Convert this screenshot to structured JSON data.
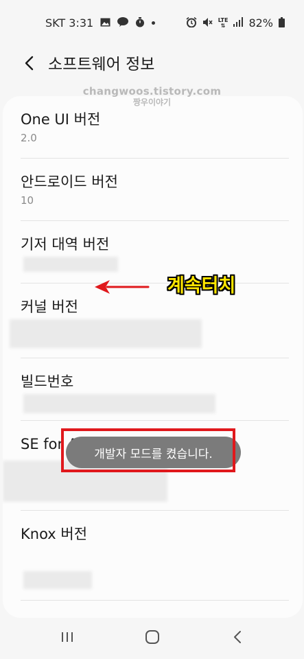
{
  "status_bar": {
    "carrier": "SKT",
    "time": "3:31",
    "lte": "LTE",
    "battery": "82%",
    "icons": [
      "gallery-icon",
      "talk-icon",
      "timer-icon",
      "alarm-icon",
      "mute-icon",
      "signal-icon",
      "battery-icon"
    ]
  },
  "header": {
    "title": "소프트웨어 정보"
  },
  "watermark": {
    "line1": "changwoos.tistory.com",
    "line2": "짱우이야기"
  },
  "items": [
    {
      "title": "One UI 버전",
      "value": "2.0"
    },
    {
      "title": "안드로이드 버전",
      "value": "10"
    },
    {
      "title": "기저 대역 버전",
      "value": ""
    },
    {
      "title": "커널 버전",
      "value": ""
    },
    {
      "title": "빌드번호",
      "value": ""
    },
    {
      "title": "SE for Android 상태",
      "value": ""
    },
    {
      "title": "Knox 버전",
      "value": ""
    }
  ],
  "annotation": {
    "text": "계속터치",
    "arrow_color": "#e0181c",
    "text_color": "#ffe600"
  },
  "toast": {
    "message": "개발자 모드를 켰습니다."
  },
  "nav": {
    "icons": [
      "recents-icon",
      "home-icon",
      "back-icon"
    ]
  }
}
